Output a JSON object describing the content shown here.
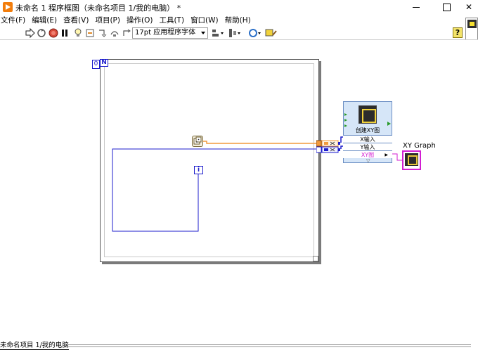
{
  "window": {
    "title": "未命名 1 程序框图（未命名项目 1/我的电脑）  *",
    "close_glyph": "✕"
  },
  "menu": {
    "items": [
      "文件(F)",
      "编辑(E)",
      "查看(V)",
      "项目(P)",
      "操作(O)",
      "工具(T)",
      "窗口(W)",
      "帮助(H)"
    ]
  },
  "toolbar": {
    "font": "17pt 应用程序字体",
    "help_glyph": "?"
  },
  "diagram": {
    "loop_count_terminal": "N",
    "loop_count_value": "0",
    "iteration_terminal": "i",
    "express_vi": {
      "title": "创建XY图",
      "inputs": [
        "X输入",
        "Y输入"
      ],
      "output": "XY图",
      "expand_glyph": "▽"
    },
    "graph_label": "XY Graph"
  },
  "status": {
    "text": "未命名项目 1/我的电脑"
  },
  "colors": {
    "dbl_wire": "#f29a3c",
    "int_wire": "#1c1ccc",
    "dynamic_wire": "#1c1ccc",
    "graph_wire": "#d21ed2"
  }
}
